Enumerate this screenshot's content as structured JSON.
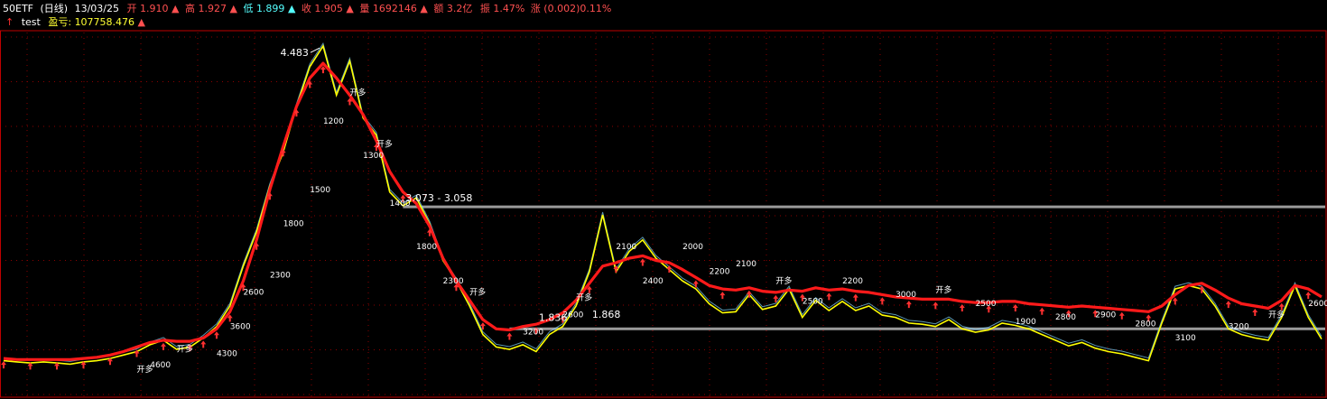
{
  "header": {
    "symbol": "50ETF",
    "period": "(日线)",
    "date": "13/03/25",
    "open_label": "开",
    "open": "1.910",
    "high_label": "高",
    "high": "1.927",
    "low_label": "低",
    "low": "1.899",
    "close_label": "收",
    "close": "1.905",
    "volume_label": "量",
    "volume": "1692146",
    "amount_label": "额",
    "amount": "3.2亿",
    "amplitude_label": "振",
    "amplitude": "1.47%",
    "change_label": "涨",
    "change": "(0.002)0.11%",
    "indicator_arrow": "↑",
    "indicator_name": "test",
    "pnl_label": "盈亏:",
    "pnl": "107758.476"
  },
  "colors": {
    "background": "#000000",
    "grid": "#8b0000",
    "border": "#c00000",
    "price": "#ffff00",
    "shadow_high": "#7fd7ff",
    "indicator": "#ff1a1a",
    "signal": "#ff3030",
    "label_text": "#ffffff",
    "hline": "#9a9a9a",
    "header_white": "#ffffff",
    "header_red": "#ff5050",
    "header_cyan": "#55ffff",
    "header_yellow": "#ffff33"
  },
  "chart_data": {
    "type": "line",
    "title": "",
    "xlabel": "",
    "ylabel": "",
    "ylim": [
      1.4,
      4.6
    ],
    "x_count": 100,
    "series": [
      {
        "name": "price",
        "values": [
          1.72,
          1.71,
          1.7,
          1.71,
          1.7,
          1.69,
          1.71,
          1.72,
          1.74,
          1.77,
          1.8,
          1.86,
          1.9,
          1.82,
          1.84,
          1.92,
          2.02,
          2.2,
          2.55,
          2.85,
          3.25,
          3.55,
          3.95,
          4.3,
          4.48,
          4.05,
          4.35,
          3.85,
          3.7,
          3.2,
          3.08,
          3.15,
          2.92,
          2.6,
          2.42,
          2.2,
          1.95,
          1.84,
          1.82,
          1.86,
          1.8,
          1.95,
          2.02,
          2.2,
          2.5,
          3.0,
          2.5,
          2.68,
          2.78,
          2.62,
          2.52,
          2.42,
          2.35,
          2.22,
          2.14,
          2.15,
          2.3,
          2.17,
          2.2,
          2.35,
          2.1,
          2.25,
          2.16,
          2.24,
          2.16,
          2.2,
          2.12,
          2.1,
          2.05,
          2.04,
          2.02,
          2.08,
          2.0,
          1.97,
          1.99,
          2.05,
          2.03,
          2.0,
          1.95,
          1.9,
          1.85,
          1.88,
          1.83,
          1.8,
          1.78,
          1.75,
          1.72,
          2.05,
          2.35,
          2.38,
          2.35,
          2.2,
          2.0,
          1.95,
          1.92,
          1.9,
          2.1,
          2.38,
          2.1,
          1.91
        ]
      },
      {
        "name": "test",
        "values": [
          1.74,
          1.73,
          1.73,
          1.73,
          1.73,
          1.73,
          1.74,
          1.75,
          1.77,
          1.8,
          1.84,
          1.88,
          1.9,
          1.89,
          1.89,
          1.92,
          2.0,
          2.15,
          2.42,
          2.78,
          3.22,
          3.6,
          3.95,
          4.2,
          4.33,
          4.2,
          4.05,
          3.88,
          3.65,
          3.38,
          3.2,
          3.1,
          2.9,
          2.62,
          2.42,
          2.25,
          2.08,
          2.0,
          1.99,
          2.02,
          2.04,
          2.08,
          2.14,
          2.25,
          2.4,
          2.55,
          2.58,
          2.62,
          2.64,
          2.6,
          2.58,
          2.52,
          2.45,
          2.38,
          2.35,
          2.34,
          2.36,
          2.33,
          2.32,
          2.34,
          2.33,
          2.36,
          2.34,
          2.35,
          2.33,
          2.32,
          2.3,
          2.28,
          2.27,
          2.26,
          2.26,
          2.26,
          2.24,
          2.23,
          2.23,
          2.24,
          2.24,
          2.22,
          2.21,
          2.2,
          2.19,
          2.2,
          2.19,
          2.18,
          2.17,
          2.16,
          2.15,
          2.2,
          2.3,
          2.38,
          2.4,
          2.34,
          2.27,
          2.22,
          2.2,
          2.18,
          2.25,
          2.38,
          2.35,
          2.28
        ]
      }
    ],
    "annotations": [
      {
        "text": "4.483",
        "x": 24,
        "y": 4.48,
        "pos": "left"
      },
      {
        "text": "3.073 - 3.058",
        "x": 30,
        "y": 3.07,
        "pos": "right"
      },
      {
        "text": "1.836",
        "x": 40,
        "y": 2.02,
        "pos": "right"
      },
      {
        "text": "1.868",
        "x": 44,
        "y": 2.05,
        "pos": "right"
      }
    ],
    "hlines": [
      {
        "y": 3.07,
        "from_x": 30
      },
      {
        "y": 2.0,
        "from_x": 38
      }
    ],
    "trade_labels": [
      {
        "text": "开多",
        "x": 10,
        "y": 1.62
      },
      {
        "text": "4600",
        "x": 11,
        "y": 1.66
      },
      {
        "text": "开多",
        "x": 13,
        "y": 1.8
      },
      {
        "text": "4300",
        "x": 16,
        "y": 1.76
      },
      {
        "text": "3600",
        "x": 17,
        "y": 2.0
      },
      {
        "text": "2600",
        "x": 18,
        "y": 2.3
      },
      {
        "text": "2300",
        "x": 20,
        "y": 2.45
      },
      {
        "text": "1800",
        "x": 21,
        "y": 2.9
      },
      {
        "text": "1500",
        "x": 23,
        "y": 3.2
      },
      {
        "text": "1200",
        "x": 24,
        "y": 3.8
      },
      {
        "text": "开多",
        "x": 26,
        "y": 4.05
      },
      {
        "text": "1300",
        "x": 27,
        "y": 3.5
      },
      {
        "text": "开多",
        "x": 28,
        "y": 3.6
      },
      {
        "text": "1400",
        "x": 29,
        "y": 3.08
      },
      {
        "text": "1800",
        "x": 31,
        "y": 2.7
      },
      {
        "text": "2300",
        "x": 33,
        "y": 2.4
      },
      {
        "text": "开多",
        "x": 35,
        "y": 2.3
      },
      {
        "text": "3200",
        "x": 39,
        "y": 1.95
      },
      {
        "text": "2600",
        "x": 42,
        "y": 2.1
      },
      {
        "text": "开多",
        "x": 43,
        "y": 2.25
      },
      {
        "text": "2100",
        "x": 46,
        "y": 2.7
      },
      {
        "text": "2400",
        "x": 48,
        "y": 2.4
      },
      {
        "text": "2000",
        "x": 51,
        "y": 2.7
      },
      {
        "text": "2200",
        "x": 53,
        "y": 2.48
      },
      {
        "text": "2100",
        "x": 55,
        "y": 2.55
      },
      {
        "text": "开多",
        "x": 58,
        "y": 2.4
      },
      {
        "text": "2500",
        "x": 60,
        "y": 2.22
      },
      {
        "text": "2200",
        "x": 63,
        "y": 2.4
      },
      {
        "text": "3000",
        "x": 67,
        "y": 2.28
      },
      {
        "text": "开多",
        "x": 70,
        "y": 2.32
      },
      {
        "text": "2500",
        "x": 73,
        "y": 2.2
      },
      {
        "text": "1900",
        "x": 76,
        "y": 2.04
      },
      {
        "text": "2800",
        "x": 79,
        "y": 2.08
      },
      {
        "text": "2900",
        "x": 82,
        "y": 2.1
      },
      {
        "text": "2800",
        "x": 85,
        "y": 2.02
      },
      {
        "text": "3100",
        "x": 88,
        "y": 1.9
      },
      {
        "text": "3200",
        "x": 92,
        "y": 2.0
      },
      {
        "text": "开多",
        "x": 95,
        "y": 2.1
      },
      {
        "text": "2600",
        "x": 98,
        "y": 2.2
      }
    ],
    "signals": [
      0,
      2,
      4,
      6,
      8,
      10,
      12,
      14,
      15,
      16,
      17,
      18,
      19,
      20,
      21,
      22,
      23,
      24,
      26,
      28,
      30,
      32,
      34,
      36,
      38,
      40,
      42,
      44,
      46,
      48,
      50,
      52,
      54,
      56,
      58,
      60,
      62,
      64,
      66,
      68,
      70,
      72,
      74,
      76,
      78,
      80,
      82,
      84,
      86,
      88,
      90,
      92,
      94,
      96,
      98
    ],
    "legend": "none",
    "grid": true
  }
}
